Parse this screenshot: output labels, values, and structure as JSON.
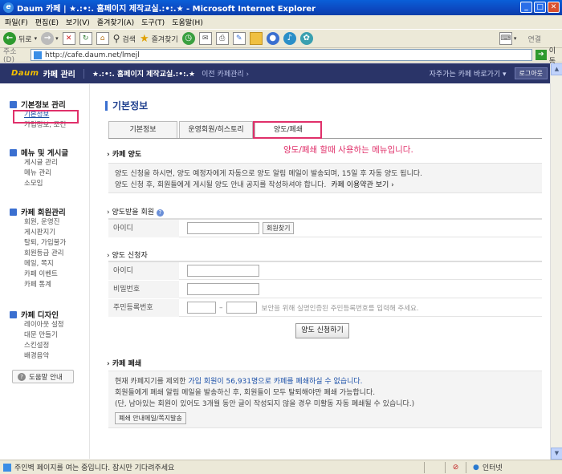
{
  "window": {
    "title": "Daum 카페 | ★.:•:. 홈페이지 제작교실.:•:.★ - Microsoft Internet Explorer"
  },
  "menubar": [
    "파일(F)",
    "편집(E)",
    "보기(V)",
    "즐겨찾기(A)",
    "도구(T)",
    "도움말(H)"
  ],
  "toolbar": {
    "back": "뒤로",
    "search": "검색",
    "favorites": "즐겨찾기",
    "connect": "연결"
  },
  "address": {
    "label": "주소(D)",
    "url": "http://cafe.daum.net/lmejl",
    "go": "이동"
  },
  "cafe_header": {
    "logo": "Daum",
    "mgmt": "카페 관리",
    "cafe_name": "★.:•:. 홈페이지 제작교실.:•:.★",
    "prev_link": "이전 카페관리 ›",
    "goto": "자주가는 카페 바로가기 ▾",
    "logout": "로그아웃"
  },
  "sidebar": {
    "sections": [
      {
        "title": "기본정보 관리",
        "icon": "info-icon",
        "color": "#3a6fd0",
        "items": [
          "기본정보",
          "가입정보, 조건"
        ]
      },
      {
        "title": "메뉴 및 게시글",
        "icon": "menu-icon",
        "color": "#3a6fd0",
        "items": [
          "게시글 관리",
          "메뉴 관리",
          "소모임"
        ]
      },
      {
        "title": "카페 회원관리",
        "icon": "members-icon",
        "color": "#3a6fd0",
        "items": [
          "회원, 운영진",
          "게시판지기",
          "탈퇴, 가입불가",
          "회원등급 관리",
          "메일, 쪽지",
          "카페 이벤트",
          "카페 통계"
        ]
      },
      {
        "title": "카페 디자인",
        "icon": "design-icon",
        "color": "#3a6fd0",
        "items": [
          "레이아웃 설정",
          "대문 만들기",
          "스킨설정",
          "배경음악"
        ]
      }
    ],
    "help": "도움말 안내"
  },
  "main": {
    "page_title": "기본정보",
    "tabs": [
      "기본정보",
      "운영회원/히스토리",
      "양도/폐쇄"
    ],
    "note": "양도/폐쇄   할때 사용하는 메뉴입니다.",
    "transfer": {
      "title": "카페 양도",
      "line1": "양도 신청을 하시면, 양도 예정자에게 자동으로 양도 알림 메일이 발송되며, 15일 후 자동 양도 됩니다.",
      "line2": "양도 신청 후, 회원들에게 게시될 양도 안내 공지를 작성하셔야 합니다.",
      "policy_link": "카페 이용약관 보기 ›"
    },
    "receiver": {
      "title": "양도받을 회원",
      "id_label": "아이디",
      "find_btn": "회원찾기"
    },
    "applicant": {
      "title": "양도 신청자",
      "id_label": "아이디",
      "pw_label": "비밀번호",
      "ssn_label": "주민등록번호",
      "ssn_sep": "–",
      "ssn_hint": "보안을 위해 실명인증된 주민등록번호를 입력해 주세요."
    },
    "apply_btn": "양도 신청하기",
    "close": {
      "title": "카페 폐쇄",
      "line1_a": "현재 카페지기를 제외한 ",
      "line1_b": "가입 회원이 56,931명",
      "line1_c": "으로 ",
      "line1_d": "카페를 폐쇄하실 수 없습니다.",
      "line2": "회원들에게 폐쇄 알림 메일을 발송하신 후, 회원들이 모두 탈퇴해야만 폐쇄 가능합니다.",
      "line3": "(단, 남아있는 회원이 있어도 3개월 동안 글이 작성되지 않을 경우 미활동 자동 폐쇄될 수 있습니다.)",
      "mail_btn": "폐쇄 안내메일/쪽지발송"
    }
  },
  "statusbar": {
    "text": "주인벽 페이지를 여는 중입니다. 잠시만 기다려주세요",
    "zone": "인터넷"
  }
}
